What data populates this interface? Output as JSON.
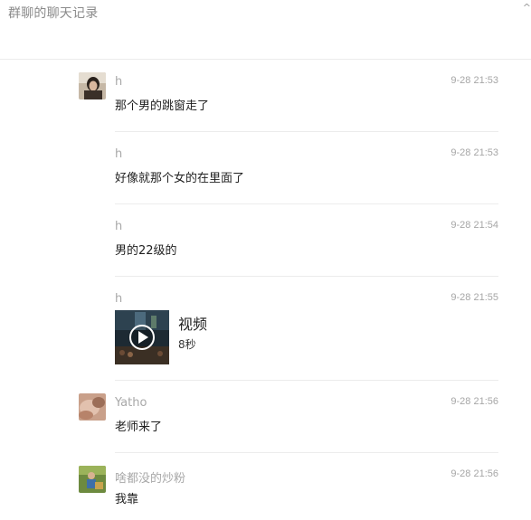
{
  "window": {
    "title": "群聊的聊天记录",
    "corner_glyph": "^"
  },
  "messages": [
    {
      "sender": "h",
      "time": "9-28 21:53",
      "text": "那个男的跳窗走了",
      "avatar": "avatar-girl"
    },
    {
      "sender": "h",
      "time": "9-28 21:53",
      "text": "好像就那个女的在里面了"
    },
    {
      "sender": "h",
      "time": "9-28 21:54",
      "text": "男的22级的"
    },
    {
      "sender": "h",
      "time": "9-28 21:55",
      "video": {
        "title": "视频",
        "duration": "8秒",
        "icon": "play-icon"
      }
    },
    {
      "sender": "Yatho",
      "time": "9-28 21:56",
      "text": "老师来了",
      "avatar": "avatar-blur"
    },
    {
      "sender": "啥都没的炒粉",
      "time": "9-28 21:56",
      "text": "我靠",
      "avatar": "avatar-outdoor"
    }
  ]
}
